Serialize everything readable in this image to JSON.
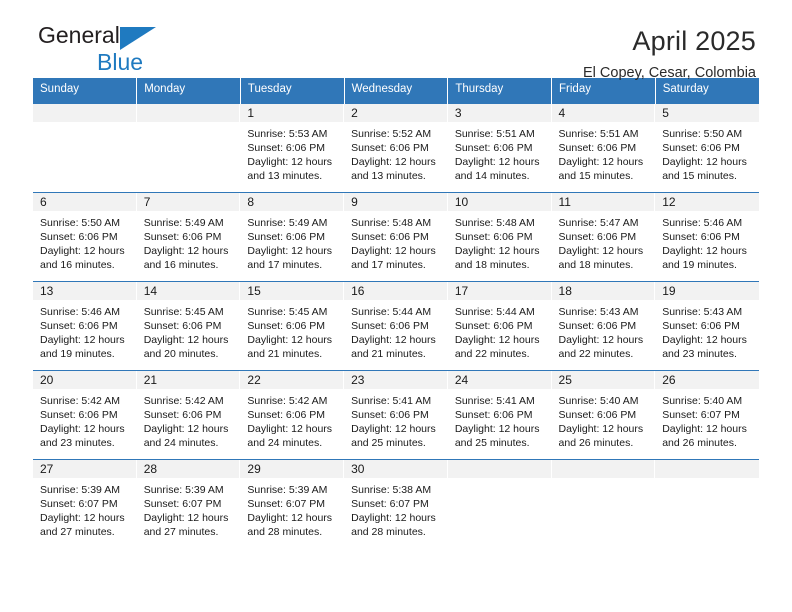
{
  "brand": {
    "line1": "General",
    "line2": "Blue",
    "triangle_color": "#1f7ac0"
  },
  "header": {
    "title": "April 2025",
    "subtitle": "El Copey, Cesar, Colombia"
  },
  "theme": {
    "header_blue": "#3077b8",
    "daynum_band": "#f2f2f2",
    "text": "#1a1a1a"
  },
  "columns": [
    "Sunday",
    "Monday",
    "Tuesday",
    "Wednesday",
    "Thursday",
    "Friday",
    "Saturday"
  ],
  "weeks": [
    [
      {
        "day": ""
      },
      {
        "day": ""
      },
      {
        "day": "1",
        "sunrise": "Sunrise: 5:53 AM",
        "sunset": "Sunset: 6:06 PM",
        "daylight1": "Daylight: 12 hours",
        "daylight2": "and 13 minutes."
      },
      {
        "day": "2",
        "sunrise": "Sunrise: 5:52 AM",
        "sunset": "Sunset: 6:06 PM",
        "daylight1": "Daylight: 12 hours",
        "daylight2": "and 13 minutes."
      },
      {
        "day": "3",
        "sunrise": "Sunrise: 5:51 AM",
        "sunset": "Sunset: 6:06 PM",
        "daylight1": "Daylight: 12 hours",
        "daylight2": "and 14 minutes."
      },
      {
        "day": "4",
        "sunrise": "Sunrise: 5:51 AM",
        "sunset": "Sunset: 6:06 PM",
        "daylight1": "Daylight: 12 hours",
        "daylight2": "and 15 minutes."
      },
      {
        "day": "5",
        "sunrise": "Sunrise: 5:50 AM",
        "sunset": "Sunset: 6:06 PM",
        "daylight1": "Daylight: 12 hours",
        "daylight2": "and 15 minutes."
      }
    ],
    [
      {
        "day": "6",
        "sunrise": "Sunrise: 5:50 AM",
        "sunset": "Sunset: 6:06 PM",
        "daylight1": "Daylight: 12 hours",
        "daylight2": "and 16 minutes."
      },
      {
        "day": "7",
        "sunrise": "Sunrise: 5:49 AM",
        "sunset": "Sunset: 6:06 PM",
        "daylight1": "Daylight: 12 hours",
        "daylight2": "and 16 minutes."
      },
      {
        "day": "8",
        "sunrise": "Sunrise: 5:49 AM",
        "sunset": "Sunset: 6:06 PM",
        "daylight1": "Daylight: 12 hours",
        "daylight2": "and 17 minutes."
      },
      {
        "day": "9",
        "sunrise": "Sunrise: 5:48 AM",
        "sunset": "Sunset: 6:06 PM",
        "daylight1": "Daylight: 12 hours",
        "daylight2": "and 17 minutes."
      },
      {
        "day": "10",
        "sunrise": "Sunrise: 5:48 AM",
        "sunset": "Sunset: 6:06 PM",
        "daylight1": "Daylight: 12 hours",
        "daylight2": "and 18 minutes."
      },
      {
        "day": "11",
        "sunrise": "Sunrise: 5:47 AM",
        "sunset": "Sunset: 6:06 PM",
        "daylight1": "Daylight: 12 hours",
        "daylight2": "and 18 minutes."
      },
      {
        "day": "12",
        "sunrise": "Sunrise: 5:46 AM",
        "sunset": "Sunset: 6:06 PM",
        "daylight1": "Daylight: 12 hours",
        "daylight2": "and 19 minutes."
      }
    ],
    [
      {
        "day": "13",
        "sunrise": "Sunrise: 5:46 AM",
        "sunset": "Sunset: 6:06 PM",
        "daylight1": "Daylight: 12 hours",
        "daylight2": "and 19 minutes."
      },
      {
        "day": "14",
        "sunrise": "Sunrise: 5:45 AM",
        "sunset": "Sunset: 6:06 PM",
        "daylight1": "Daylight: 12 hours",
        "daylight2": "and 20 minutes."
      },
      {
        "day": "15",
        "sunrise": "Sunrise: 5:45 AM",
        "sunset": "Sunset: 6:06 PM",
        "daylight1": "Daylight: 12 hours",
        "daylight2": "and 21 minutes."
      },
      {
        "day": "16",
        "sunrise": "Sunrise: 5:44 AM",
        "sunset": "Sunset: 6:06 PM",
        "daylight1": "Daylight: 12 hours",
        "daylight2": "and 21 minutes."
      },
      {
        "day": "17",
        "sunrise": "Sunrise: 5:44 AM",
        "sunset": "Sunset: 6:06 PM",
        "daylight1": "Daylight: 12 hours",
        "daylight2": "and 22 minutes."
      },
      {
        "day": "18",
        "sunrise": "Sunrise: 5:43 AM",
        "sunset": "Sunset: 6:06 PM",
        "daylight1": "Daylight: 12 hours",
        "daylight2": "and 22 minutes."
      },
      {
        "day": "19",
        "sunrise": "Sunrise: 5:43 AM",
        "sunset": "Sunset: 6:06 PM",
        "daylight1": "Daylight: 12 hours",
        "daylight2": "and 23 minutes."
      }
    ],
    [
      {
        "day": "20",
        "sunrise": "Sunrise: 5:42 AM",
        "sunset": "Sunset: 6:06 PM",
        "daylight1": "Daylight: 12 hours",
        "daylight2": "and 23 minutes."
      },
      {
        "day": "21",
        "sunrise": "Sunrise: 5:42 AM",
        "sunset": "Sunset: 6:06 PM",
        "daylight1": "Daylight: 12 hours",
        "daylight2": "and 24 minutes."
      },
      {
        "day": "22",
        "sunrise": "Sunrise: 5:42 AM",
        "sunset": "Sunset: 6:06 PM",
        "daylight1": "Daylight: 12 hours",
        "daylight2": "and 24 minutes."
      },
      {
        "day": "23",
        "sunrise": "Sunrise: 5:41 AM",
        "sunset": "Sunset: 6:06 PM",
        "daylight1": "Daylight: 12 hours",
        "daylight2": "and 25 minutes."
      },
      {
        "day": "24",
        "sunrise": "Sunrise: 5:41 AM",
        "sunset": "Sunset: 6:06 PM",
        "daylight1": "Daylight: 12 hours",
        "daylight2": "and 25 minutes."
      },
      {
        "day": "25",
        "sunrise": "Sunrise: 5:40 AM",
        "sunset": "Sunset: 6:06 PM",
        "daylight1": "Daylight: 12 hours",
        "daylight2": "and 26 minutes."
      },
      {
        "day": "26",
        "sunrise": "Sunrise: 5:40 AM",
        "sunset": "Sunset: 6:07 PM",
        "daylight1": "Daylight: 12 hours",
        "daylight2": "and 26 minutes."
      }
    ],
    [
      {
        "day": "27",
        "sunrise": "Sunrise: 5:39 AM",
        "sunset": "Sunset: 6:07 PM",
        "daylight1": "Daylight: 12 hours",
        "daylight2": "and 27 minutes."
      },
      {
        "day": "28",
        "sunrise": "Sunrise: 5:39 AM",
        "sunset": "Sunset: 6:07 PM",
        "daylight1": "Daylight: 12 hours",
        "daylight2": "and 27 minutes."
      },
      {
        "day": "29",
        "sunrise": "Sunrise: 5:39 AM",
        "sunset": "Sunset: 6:07 PM",
        "daylight1": "Daylight: 12 hours",
        "daylight2": "and 28 minutes."
      },
      {
        "day": "30",
        "sunrise": "Sunrise: 5:38 AM",
        "sunset": "Sunset: 6:07 PM",
        "daylight1": "Daylight: 12 hours",
        "daylight2": "and 28 minutes."
      },
      {
        "day": ""
      },
      {
        "day": ""
      },
      {
        "day": ""
      }
    ]
  ]
}
